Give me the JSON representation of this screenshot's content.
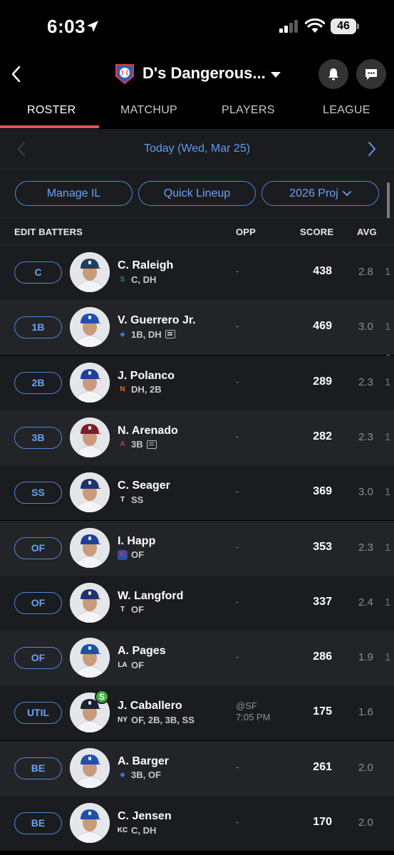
{
  "status": {
    "time": "6:03",
    "battery": "46"
  },
  "header": {
    "team_name": "D's Dangerous..."
  },
  "tabs": [
    {
      "label": "ROSTER",
      "active": true
    },
    {
      "label": "MATCHUP",
      "active": false
    },
    {
      "label": "PLAYERS",
      "active": false
    },
    {
      "label": "LEAGUE",
      "active": false
    }
  ],
  "date": {
    "label": "Today (Wed, Mar 25)"
  },
  "pills": {
    "manage_il": "Manage IL",
    "quick_lineup": "Quick Lineup",
    "projection": "2026 Proj"
  },
  "columns": {
    "edit": "EDIT BATTERS",
    "opp": "OPP",
    "score": "SCORE",
    "avg": "AVG"
  },
  "players": [
    {
      "slot": "C",
      "name": "C. Raleigh",
      "positions": "C, DH",
      "team_icon": "mariners-icon",
      "news": false,
      "opp": "-",
      "score": "438",
      "avg": "2.8",
      "clip": "1"
    },
    {
      "slot": "1B",
      "name": "V. Guerrero Jr.",
      "positions": "1B, DH",
      "team_icon": "bluejays-icon",
      "news": true,
      "opp": "-",
      "score": "469",
      "avg": "3.0",
      "clip": "1"
    },
    {
      "slot": "2B",
      "name": "J. Polanco",
      "positions": "DH, 2B",
      "team_icon": "mets-icon",
      "news": false,
      "opp": "-",
      "score": "289",
      "avg": "2.3",
      "clip": "1"
    },
    {
      "slot": "3B",
      "name": "N. Arenado",
      "positions": "3B",
      "team_icon": "dbacks-icon",
      "news": true,
      "opp": "-",
      "score": "282",
      "avg": "2.3",
      "clip": "1"
    },
    {
      "slot": "SS",
      "name": "C. Seager",
      "positions": "SS",
      "team_icon": "rangers-icon",
      "news": false,
      "opp": "-",
      "score": "369",
      "avg": "3.0",
      "clip": "1"
    },
    {
      "slot": "OF",
      "name": "I. Happ",
      "positions": "OF",
      "team_icon": "cubs-icon",
      "news": false,
      "opp": "-",
      "score": "353",
      "avg": "2.3",
      "clip": "1"
    },
    {
      "slot": "OF",
      "name": "W. Langford",
      "positions": "OF",
      "team_icon": "rangers-icon",
      "news": false,
      "opp": "-",
      "score": "337",
      "avg": "2.4",
      "clip": "1"
    },
    {
      "slot": "OF",
      "name": "A. Pages",
      "positions": "OF",
      "team_icon": "dodgers-icon",
      "news": false,
      "opp": "-",
      "score": "286",
      "avg": "1.9",
      "clip": "1"
    },
    {
      "slot": "UTIL",
      "name": "J. Caballero",
      "positions": "OF, 2B, 3B, SS",
      "team_icon": "yankees-icon",
      "news": false,
      "opp": "@SF",
      "opp_time": "7:05 PM",
      "badge": "S",
      "score": "175",
      "avg": "1.6",
      "clip": ""
    },
    {
      "slot": "BE",
      "name": "A. Barger",
      "positions": "3B, OF",
      "team_icon": "bluejays-icon",
      "news": false,
      "opp": "-",
      "score": "261",
      "avg": "2.0",
      "clip": ""
    },
    {
      "slot": "BE",
      "name": "C. Jensen",
      "positions": "C, DH",
      "team_icon": "royals-icon",
      "news": false,
      "opp": "-",
      "score": "170",
      "avg": "2.0",
      "clip": ""
    }
  ],
  "colors": {
    "accent": "#6aa2f5",
    "tab_underline": "#e35353",
    "starter_badge": "#3fae3f"
  }
}
